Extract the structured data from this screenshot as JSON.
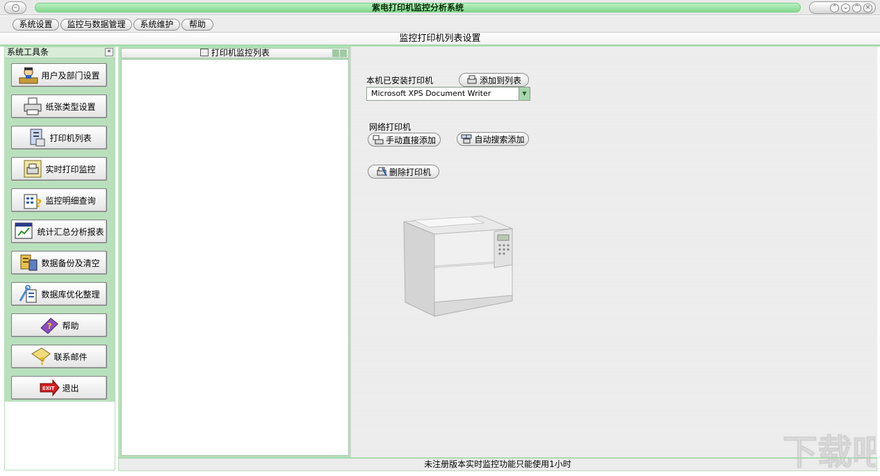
{
  "window": {
    "title": "紫电打印机监控分析系统",
    "controls": [
      "minimize-icon",
      "restore-icon",
      "maximize-icon",
      "close-icon"
    ]
  },
  "menu": [
    "系统设置",
    "监控与数据管理",
    "系统维护",
    "帮助"
  ],
  "page_title": "监控打印机列表设置",
  "sidebar": {
    "title": "系统工具条",
    "collapse_label": "«",
    "items": [
      {
        "label": "用户及部门设置",
        "icon": "user-department-icon"
      },
      {
        "label": "纸张类型设置",
        "icon": "printer-paper-icon"
      },
      {
        "label": "打印机列表",
        "icon": "printer-list-icon"
      },
      {
        "label": "实时打印监控",
        "icon": "realtime-monitor-icon"
      },
      {
        "label": "监控明细查询",
        "icon": "detail-query-icon"
      },
      {
        "label": "统计汇总分析报表",
        "icon": "report-chart-icon"
      },
      {
        "label": "数据备份及清空",
        "icon": "backup-icon"
      },
      {
        "label": "数据库优化整理",
        "icon": "database-tools-icon"
      },
      {
        "label": "帮助",
        "icon": "help-book-icon"
      },
      {
        "label": "联系邮件",
        "icon": "mail-icon"
      },
      {
        "label": "退出",
        "icon": "exit-icon"
      }
    ]
  },
  "middle_panel": {
    "title": "打印机监控列表",
    "items": []
  },
  "content": {
    "local_label": "本机已安装打印机",
    "add_to_list": "添加到列表",
    "selected_printer": "Microsoft XPS Document Writer",
    "network_label": "网络打印机",
    "manual_add": "手动直接添加",
    "auto_add": "自动搜索添加",
    "delete_printer": "删除打印机"
  },
  "status_text": "未注册版本实时监控功能只能使用1小时",
  "watermark": {
    "text": "下载吧",
    "url": "www.xiazaiba.com"
  },
  "colors": {
    "accent_green": "#84d98f",
    "panel_green": "#b9e0bd",
    "border_green": "#a6dcae"
  }
}
